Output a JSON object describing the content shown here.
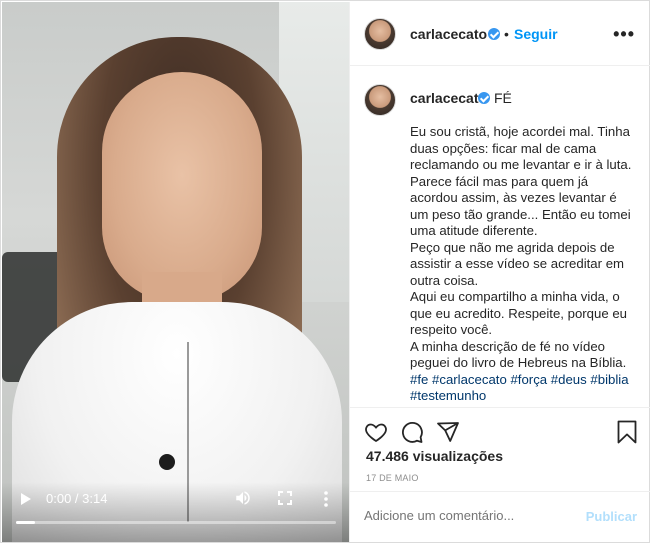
{
  "post": {
    "username": "carlacecato",
    "follow_label": "Seguir",
    "dot": "•",
    "options_label": "•••"
  },
  "video": {
    "time": "0:00 / 3:14",
    "progress_fraction": 0.06
  },
  "caption": {
    "username": "carlacecato",
    "title": "FÉ",
    "lines": [
      "Eu sou cristã, hoje acordei mal. Tinha duas opções: ficar mal de cama reclamando ou me levantar e ir à luta. Parece fácil mas para quem já acordou assim, às vezes levantar é um peso tão grande... Então eu tomei uma atitude diferente.",
      "Peço que não me agrida depois de assistir a esse vídeo se acreditar em outra coisa.",
      "Aqui eu compartilho a minha vida, o que eu acredito. Respeite, porque eu respeito você.",
      "A minha descrição de fé no vídeo peguei do livro de Hebreus na Bíblia."
    ],
    "hashtags": [
      "#fe",
      "#carlacecato",
      "#força",
      "#deus",
      "#biblia",
      "#testemunho"
    ]
  },
  "stats": {
    "views": "47.486 visualizações",
    "date": "17 DE MAIO"
  },
  "comment": {
    "placeholder": "Adicione um comentário...",
    "publish_label": "Publicar"
  },
  "colors": {
    "accent": "#0095f6",
    "verified": "#3897f0",
    "hashtag": "#00376b",
    "muted": "#8e8e8e"
  },
  "icons": [
    "play-icon",
    "volume-icon",
    "fullscreen-icon",
    "more-vert-icon",
    "verified-icon",
    "options-icon",
    "heart-icon",
    "comment-icon",
    "share-icon",
    "bookmark-icon"
  ]
}
